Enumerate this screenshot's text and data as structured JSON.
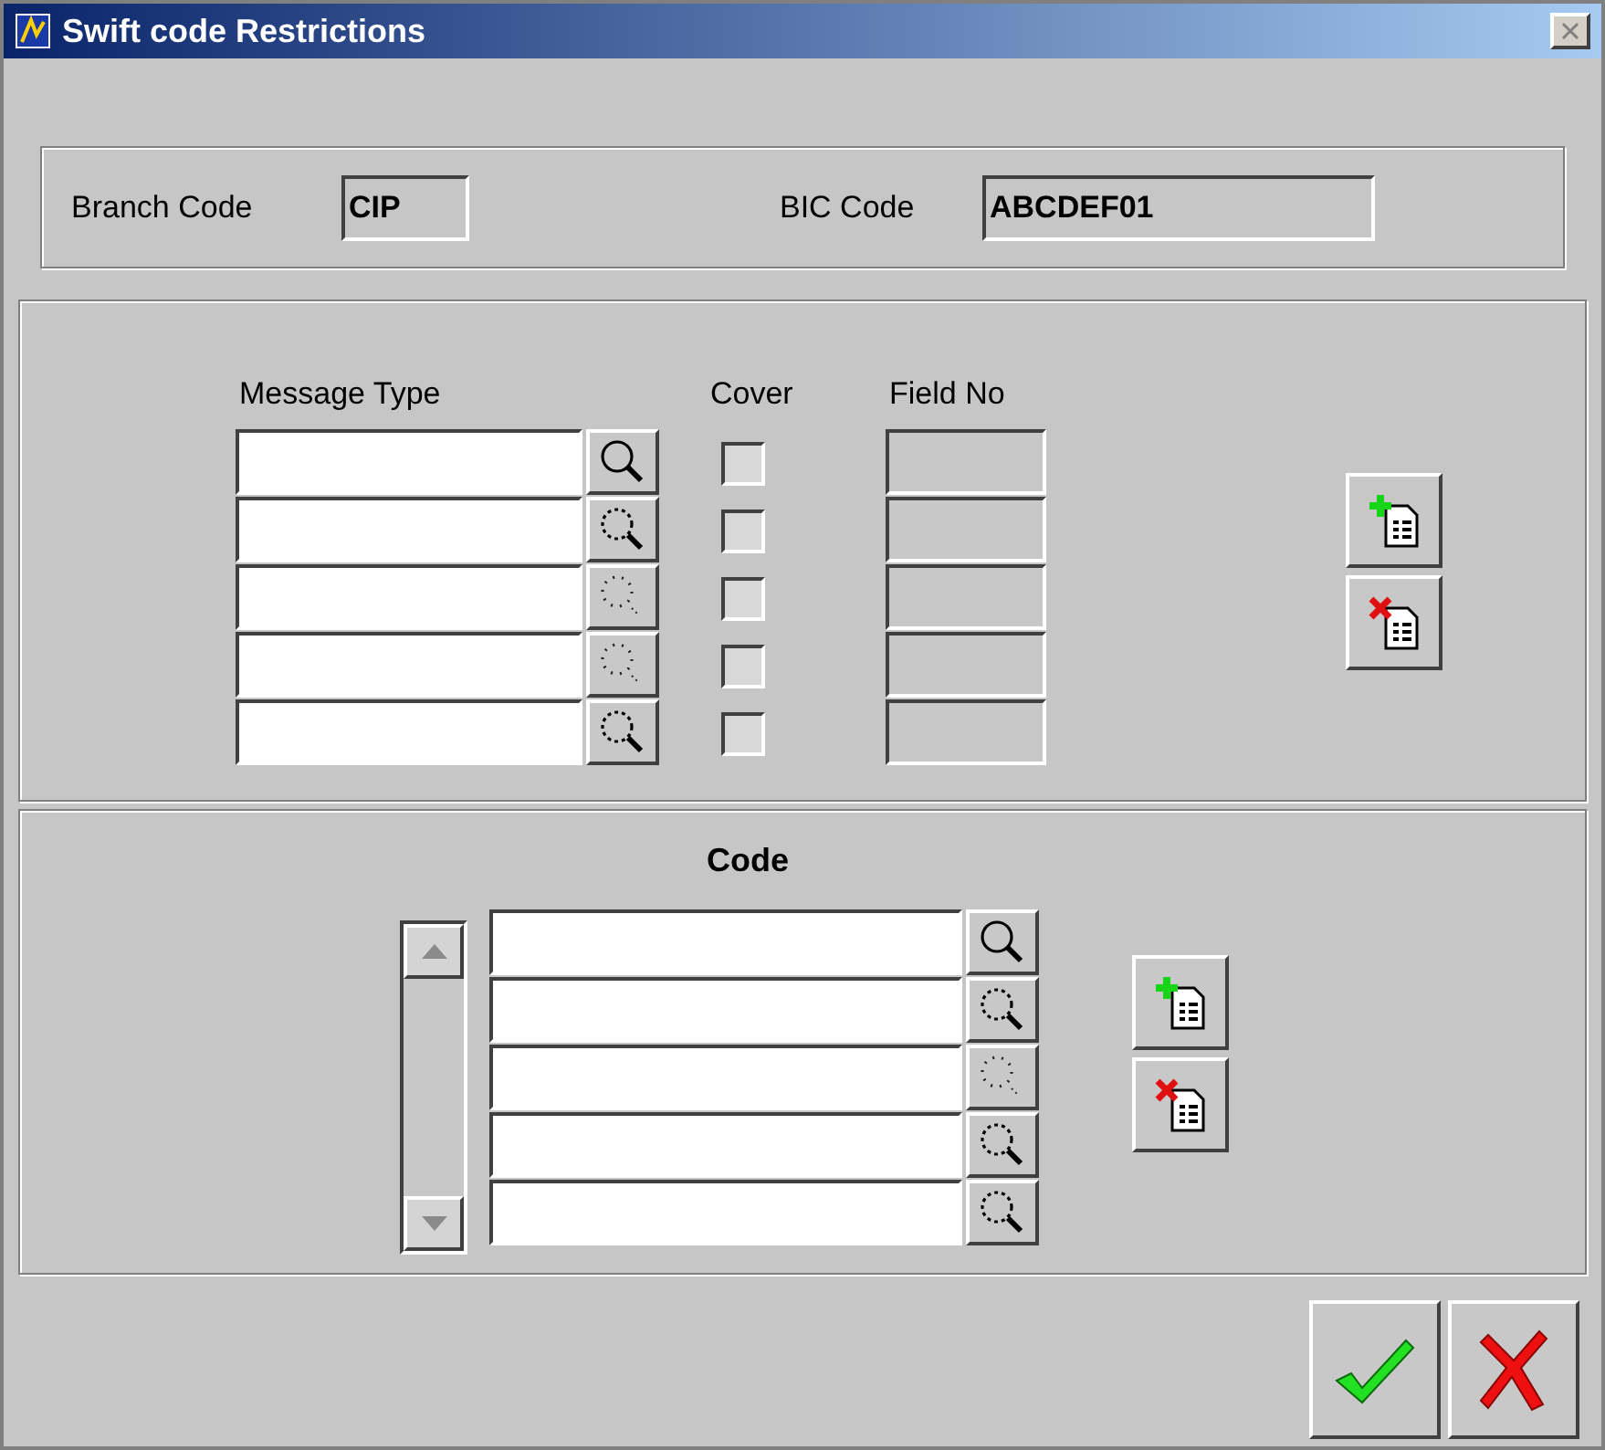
{
  "window": {
    "title": "Swift code Restrictions"
  },
  "header": {
    "branch_code": {
      "label": "Branch Code",
      "value": "CIP"
    },
    "bic_code": {
      "label": "BIC Code",
      "value": "ABCDEF01"
    }
  },
  "message_section": {
    "columns": [
      "Message Type",
      "Cover",
      "Field No"
    ],
    "rows": [
      {
        "kind": "solid",
        "checked": false
      },
      {
        "kind": "dotted",
        "checked": false
      },
      {
        "kind": "faint",
        "checked": false
      },
      {
        "kind": "faint",
        "checked": false
      },
      {
        "kind": "dotted",
        "checked": false
      }
    ]
  },
  "code_section": {
    "title": "Code",
    "rows": [
      {
        "kind": "solid"
      },
      {
        "kind": "dotted"
      },
      {
        "kind": "faint"
      },
      {
        "kind": "dotted"
      },
      {
        "kind": "dotted"
      }
    ]
  }
}
